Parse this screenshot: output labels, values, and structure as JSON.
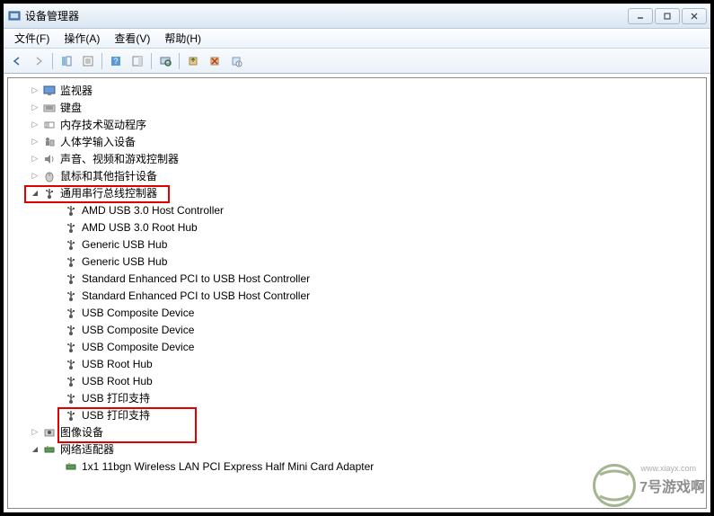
{
  "window": {
    "title": "设备管理器"
  },
  "menu": {
    "file": "文件(F)",
    "action": "操作(A)",
    "view": "查看(V)",
    "help": "帮助(H)"
  },
  "tree": {
    "monitors": "监视器",
    "keyboard": "键盘",
    "memory": "内存技术驱动程序",
    "hid": "人体学输入设备",
    "sound": "声音、视频和游戏控制器",
    "mouse": "鼠标和其他指针设备",
    "usb_controllers": "通用串行总线控制器",
    "usb_items": [
      "AMD USB 3.0 Host Controller",
      "AMD USB 3.0 Root Hub",
      "Generic USB Hub",
      "Generic USB Hub",
      "Standard Enhanced PCI to USB Host Controller",
      "Standard Enhanced PCI to USB Host Controller",
      "USB Composite Device",
      "USB Composite Device",
      "USB Composite Device",
      "USB Root Hub",
      "USB Root Hub",
      "USB 打印支持",
      "USB 打印支持"
    ],
    "imaging": "图像设备",
    "network": "网络适配器",
    "network_item": "1x1 11bgn Wireless LAN PCI Express Half Mini Card Adapter"
  },
  "watermark": {
    "main": "7号游戏啊",
    "url": "www.xiayx.com"
  }
}
